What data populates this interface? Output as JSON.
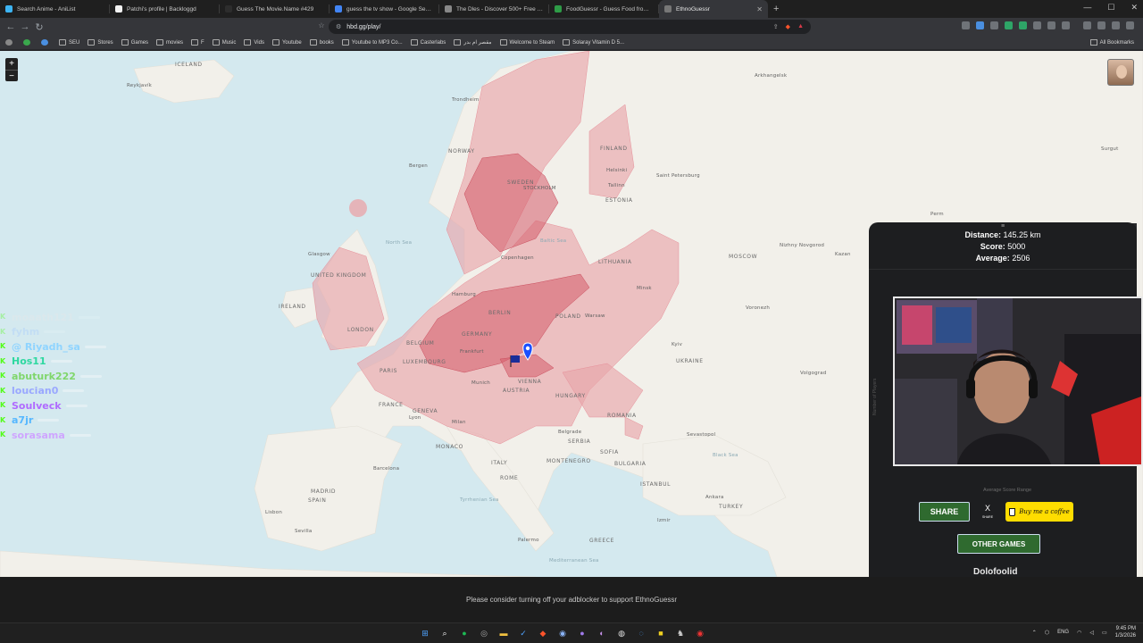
{
  "browser": {
    "tabs": [
      {
        "label": "Search Anime - AniList",
        "color": "#3db4f2",
        "active": false
      },
      {
        "label": "Patchi's profile | Backloggd",
        "color": "#f2f2f2",
        "active": false
      },
      {
        "label": "Guess The Movie.Name #429",
        "color": "#2d2d2d",
        "active": false
      },
      {
        "label": "guess the tv show - Google Search",
        "color": "#4285f4",
        "active": false
      },
      {
        "label": "The Dles - Discover 500+ Free Daily",
        "color": "#888888",
        "active": false
      },
      {
        "label": "FoodGuessr - Guess Food from Arou",
        "color": "#2e9c47",
        "active": false
      },
      {
        "label": "EthnoGuessr",
        "color": "#777777",
        "active": true
      }
    ],
    "url": "hbd.gg/play/",
    "bookmarks": [
      "SEU",
      "Stores",
      "Games",
      "movies",
      "F",
      "Music",
      "Vids",
      "Youtube",
      "books",
      "Youtube to MP3 Co...",
      "Casterlabs",
      "مقصر ام بدر",
      "Welcome to Steam",
      "Solaray Vitamin D 5..."
    ],
    "all_bookmarks": "All Bookmarks"
  },
  "map": {
    "zoom_in": "+",
    "zoom_out": "−",
    "labels": {
      "iceland": "ICELAND",
      "reykjavik": "Reykjavík",
      "norway": "NORWAY",
      "trondheim": "Trondheim",
      "bergen": "Bergen",
      "sweden": "SWEDEN",
      "stockholm": "STOCKHOLM",
      "finland": "FINLAND",
      "helsinki": "Helsinki",
      "tallinn": "Tallinn",
      "estonia": "ESTONIA",
      "stpetersburg": "Saint Petersburg",
      "arkhangelsk": "Arkhangelsk",
      "surgut": "Surgut",
      "perm": "Perm",
      "nizhny": "Nizhny Novgorod",
      "moscow": "MOSCOW",
      "kazan": "Kazan",
      "glasgow": "Glasgow",
      "uk": "UNITED KINGDOM",
      "ireland": "IRELAND",
      "london": "LONDON",
      "copenhagen": "Copenhagen",
      "northsea": "North Sea",
      "hamburg": "Hamburg",
      "berlin": "BERLIN",
      "germany": "GERMANY",
      "belgium": "BELGIUM",
      "luxembourg": "LUXEMBOURG",
      "frankfurt": "Frankfurt",
      "paris": "PARIS",
      "france": "FRANCE",
      "poland": "POLAND",
      "warsaw": "Warsaw",
      "lithuania": "LITHUANIA",
      "minsk": "Minsk",
      "kyiv": "Kyiv",
      "ukraine": "UKRAINE",
      "voronezh": "Voronezh",
      "volgograd": "Volgograd",
      "munich": "Munich",
      "vienna": "VIENNA",
      "austria": "AUSTRIA",
      "hungary": "HUNGARY",
      "romania": "ROMANIA",
      "geneva": "GENEVA",
      "lyon": "Lyon",
      "milan": "Milan",
      "monaco": "MONACO",
      "belgrade": "Belgrade",
      "serbia": "SERBIA",
      "sofia": "SOFIA",
      "bulgaria": "BULGARIA",
      "montenegro": "MONTENEGRO",
      "italy": "ITALY",
      "rome": "ROME",
      "madrid": "MADRID",
      "spain": "SPAIN",
      "lisbon": "Lisbon",
      "seville": "Sevilla",
      "barcelona": "Barcelona",
      "palermo": "Palermo",
      "istanbul": "ISTANBUL",
      "turkey": "TURKEY",
      "sevastopol": "Sevastopol",
      "greece": "GREECE",
      "izmir": "Izmir",
      "ankara": "Ankara",
      "tyrrhenian": "Tyrrhenian Sea",
      "med": "Mediterranean Sea",
      "baltic": "Baltic Sea",
      "black": "Black Sea"
    }
  },
  "chat": [
    {
      "name": "moaath121",
      "color": "#e8e8e8",
      "faded": true
    },
    {
      "name": "fyhm",
      "color": "#a3c9ff",
      "faded": true
    },
    {
      "name": "@ Riyadh_sa",
      "color": "#8fd4ff",
      "faded": false
    },
    {
      "name": "Hos11",
      "color": "#2ed8a0",
      "faded": false
    },
    {
      "name": "abuturk222",
      "color": "#7fd66b",
      "faded": false
    },
    {
      "name": "loucian0",
      "color": "#9aa8ff",
      "faded": false
    },
    {
      "name": "Soulveck",
      "color": "#b06bff",
      "faded": false
    },
    {
      "name": "a7jr",
      "color": "#55b7ff",
      "faded": false
    },
    {
      "name": "sorasama",
      "color": "#cfa5ff",
      "faded": false
    }
  ],
  "results": {
    "distance_label": "Distance:",
    "distance_value": "145.25 km",
    "score_label": "Score:",
    "score_value": "5000",
    "average_label": "Average:",
    "average_value": "2506",
    "chart_ylabel": "Number of Players",
    "chart_xlabel": "Average Score Range",
    "share": "SHARE",
    "x_share": "X",
    "x_share_sub": "SHARE",
    "coffee": "Buy me a coffee",
    "other_games": "OTHER GAMES",
    "next_heading": "Dolofoolid"
  },
  "adbar": {
    "text": "Please consider turning off your adblocker to support EthnoGuessr"
  },
  "taskbar": {
    "lang": "ENG",
    "time": "9:45 PM",
    "date": "1/3/2026"
  }
}
